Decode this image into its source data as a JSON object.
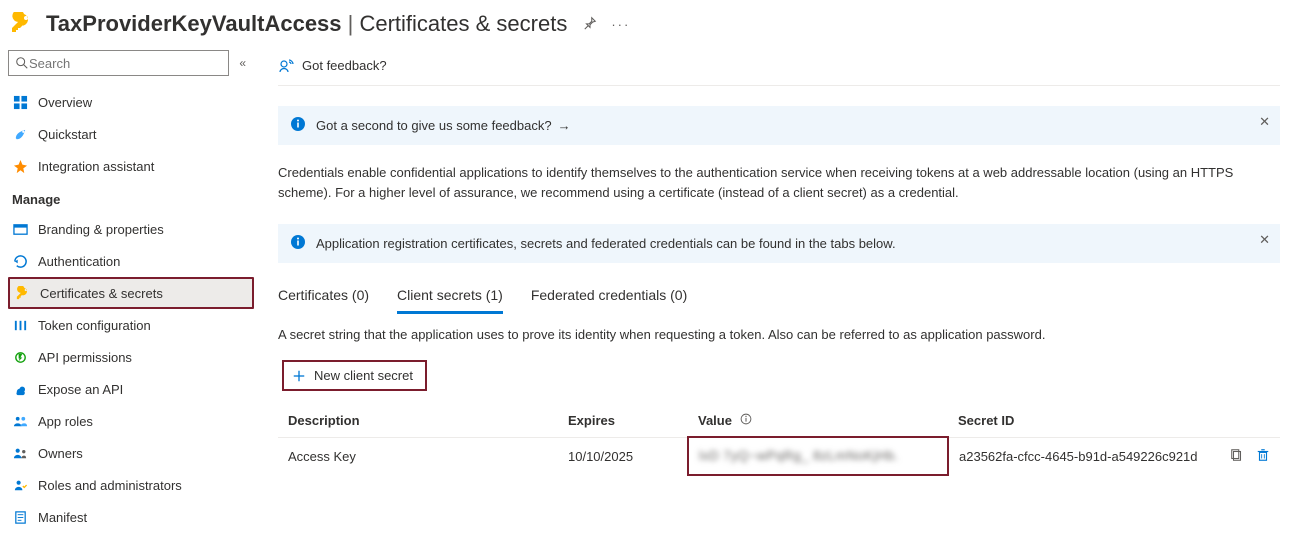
{
  "header": {
    "app_name": "TaxProviderKeyVaultAccess",
    "separator": " | ",
    "page_title": "Certificates & secrets"
  },
  "sidebar": {
    "search_placeholder": "Search",
    "items_top": [
      {
        "label": "Overview",
        "icon": "overview"
      },
      {
        "label": "Quickstart",
        "icon": "quickstart"
      },
      {
        "label": "Integration assistant",
        "icon": "integration"
      }
    ],
    "manage_heading": "Manage",
    "items_manage": [
      {
        "label": "Branding & properties",
        "icon": "branding"
      },
      {
        "label": "Authentication",
        "icon": "auth"
      },
      {
        "label": "Certificates & secrets",
        "icon": "certs",
        "active": true
      },
      {
        "label": "Token configuration",
        "icon": "token"
      },
      {
        "label": "API permissions",
        "icon": "apiperm"
      },
      {
        "label": "Expose an API",
        "icon": "expose"
      },
      {
        "label": "App roles",
        "icon": "approles"
      },
      {
        "label": "Owners",
        "icon": "owners"
      },
      {
        "label": "Roles and administrators",
        "icon": "rolesadmin"
      },
      {
        "label": "Manifest",
        "icon": "manifest"
      }
    ]
  },
  "main": {
    "feedback_link": "Got feedback?",
    "banner1": "Got a second to give us some feedback?",
    "description": "Credentials enable confidential applications to identify themselves to the authentication service when receiving tokens at a web addressable location (using an HTTPS scheme). For a higher level of assurance, we recommend using a certificate (instead of a client secret) as a credential.",
    "banner2": "Application registration certificates, secrets and federated credentials can be found in the tabs below.",
    "tabs": [
      {
        "label": "Certificates (0)"
      },
      {
        "label": "Client secrets (1)",
        "active": true
      },
      {
        "label": "Federated credentials (0)"
      }
    ],
    "tab_description": "A secret string that the application uses to prove its identity when requesting a token. Also can be referred to as application password.",
    "new_secret_label": "New client secret",
    "table": {
      "headers": {
        "description": "Description",
        "expires": "Expires",
        "value": "Value",
        "secret_id": "Secret ID"
      },
      "rows": [
        {
          "description": "Access Key",
          "expires": "10/10/2025",
          "value_masked": "lxD 7yQ~wPqRg_ 8zLmNoKjHb.",
          "secret_id": "a23562fa-cfcc-4645-b91d-a549226c921d"
        }
      ]
    }
  }
}
